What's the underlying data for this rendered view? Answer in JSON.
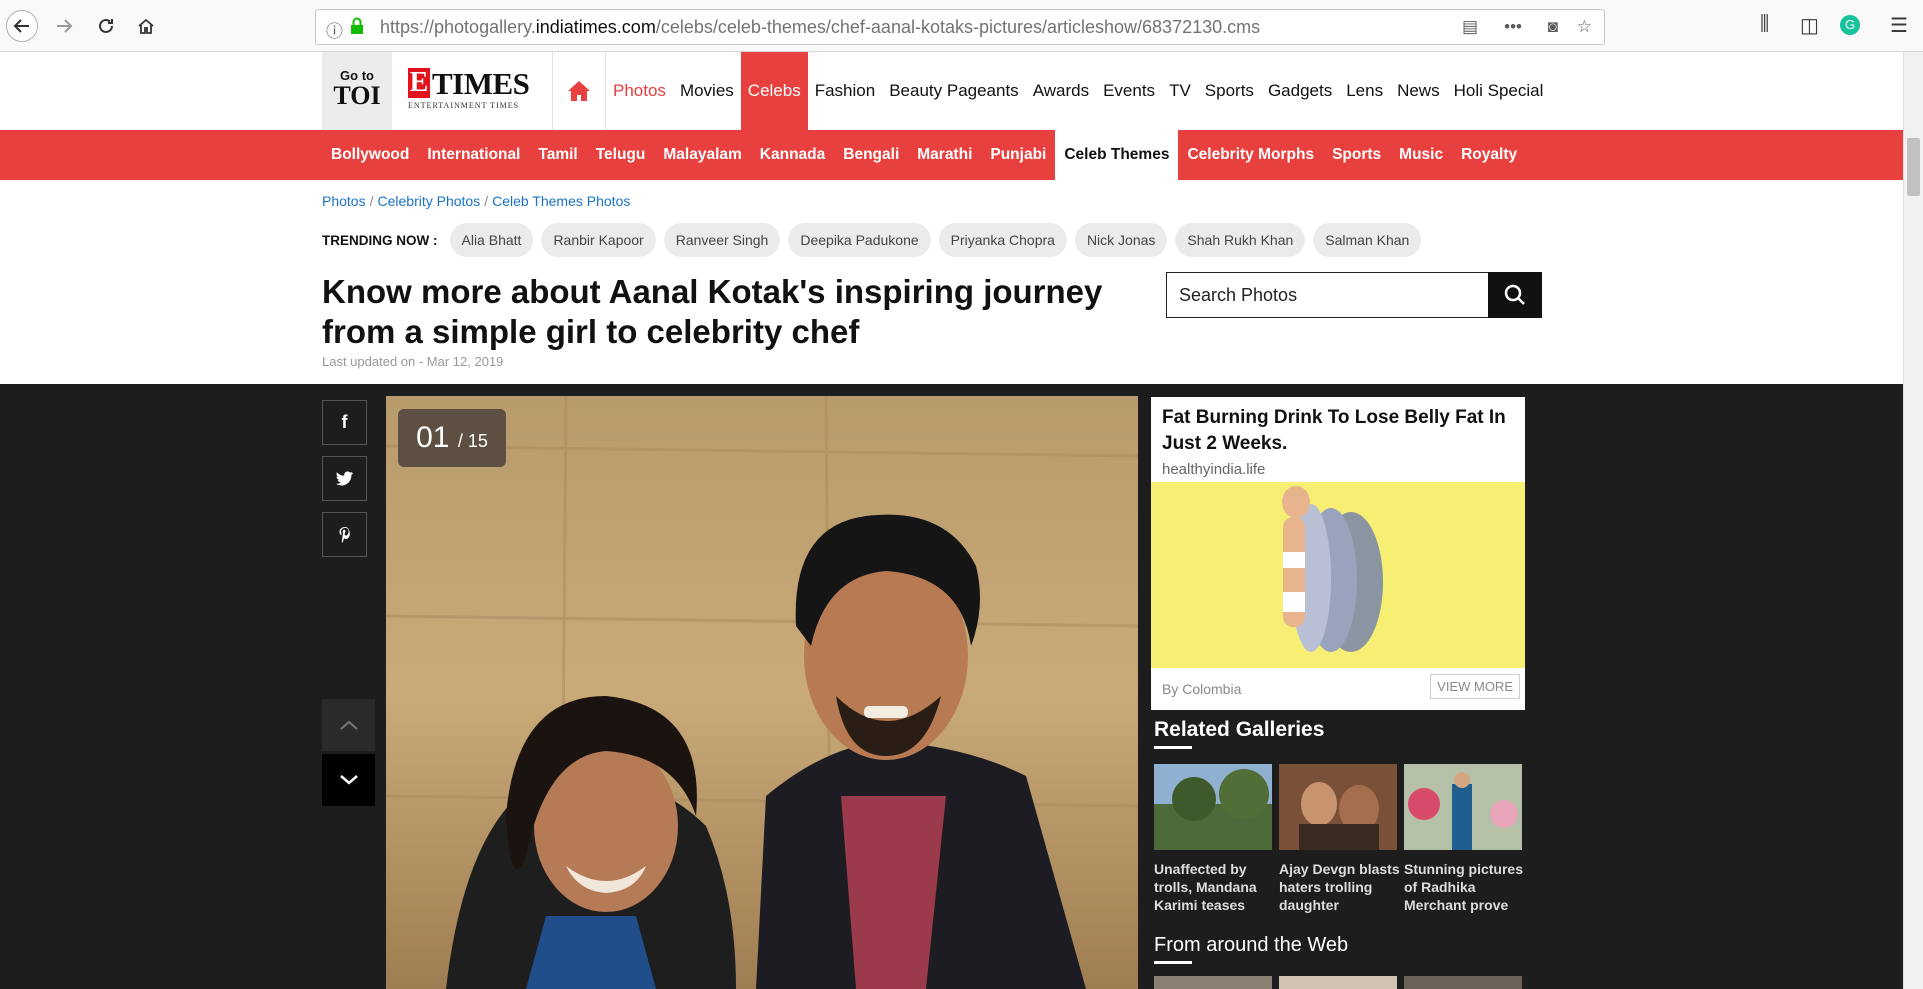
{
  "browser": {
    "url_prefix": "https://photogallery.",
    "url_domain": "indiatimes.com",
    "url_path": "/celebs/celeb-themes/chef-aanal-kotaks-pictures/articleshow/68372130.cms"
  },
  "header": {
    "goto_small": "Go to",
    "goto_big": "TOI",
    "logo_e": "E",
    "logo_times": "TIMES",
    "logo_tag": "ENTERTAINMENT TIMES",
    "nav": [
      "Photos",
      "Movies",
      "Celebs",
      "Fashion",
      "Beauty Pageants",
      "Awards",
      "Events",
      "TV",
      "Sports",
      "Gadgets",
      "Lens",
      "News",
      "Holi Special"
    ],
    "nav_active": "Celebs"
  },
  "subnav": {
    "items": [
      "Bollywood",
      "International",
      "Tamil",
      "Telugu",
      "Malayalam",
      "Kannada",
      "Bengali",
      "Marathi",
      "Punjabi",
      "Celeb Themes",
      "Celebrity Morphs",
      "Sports",
      "Music",
      "Royalty"
    ],
    "active": "Celeb Themes"
  },
  "breadcrumb": [
    "Photos",
    "Celebrity Photos",
    "Celeb Themes Photos"
  ],
  "trending": {
    "label": "TRENDING NOW :",
    "items": [
      "Alia Bhatt",
      "Ranbir Kapoor",
      "Ranveer Singh",
      "Deepika Padukone",
      "Priyanka Chopra",
      "Nick Jonas",
      "Shah Rukh Khan",
      "Salman Khan"
    ]
  },
  "article": {
    "title": "Know more about Aanal Kotak's inspiring journey from a simple girl to celebrity chef",
    "updated": "Last updated on - Mar 12, 2019"
  },
  "search": {
    "placeholder": "Search Photos"
  },
  "gallery": {
    "current": "01",
    "total": "/ 15"
  },
  "ad": {
    "title": "Fat Burning Drink To Lose Belly Fat In Just 2 Weeks.",
    "source": "healthyindia.life",
    "by": "By Colombia",
    "cta": "VIEW MORE"
  },
  "related": {
    "heading": "Related Galleries",
    "items": [
      {
        "caption": "Unaffected by trolls, Mandana Karimi teases"
      },
      {
        "caption": "Ajay Devgn blasts haters trolling daughter"
      },
      {
        "caption": "Stunning pictures of Radhika Merchant prove"
      }
    ]
  },
  "web": {
    "heading": "From around the Web"
  },
  "colors": {
    "accent": "#e8403f",
    "dark_bg": "#1d1d1d",
    "link": "#1a73c9"
  }
}
